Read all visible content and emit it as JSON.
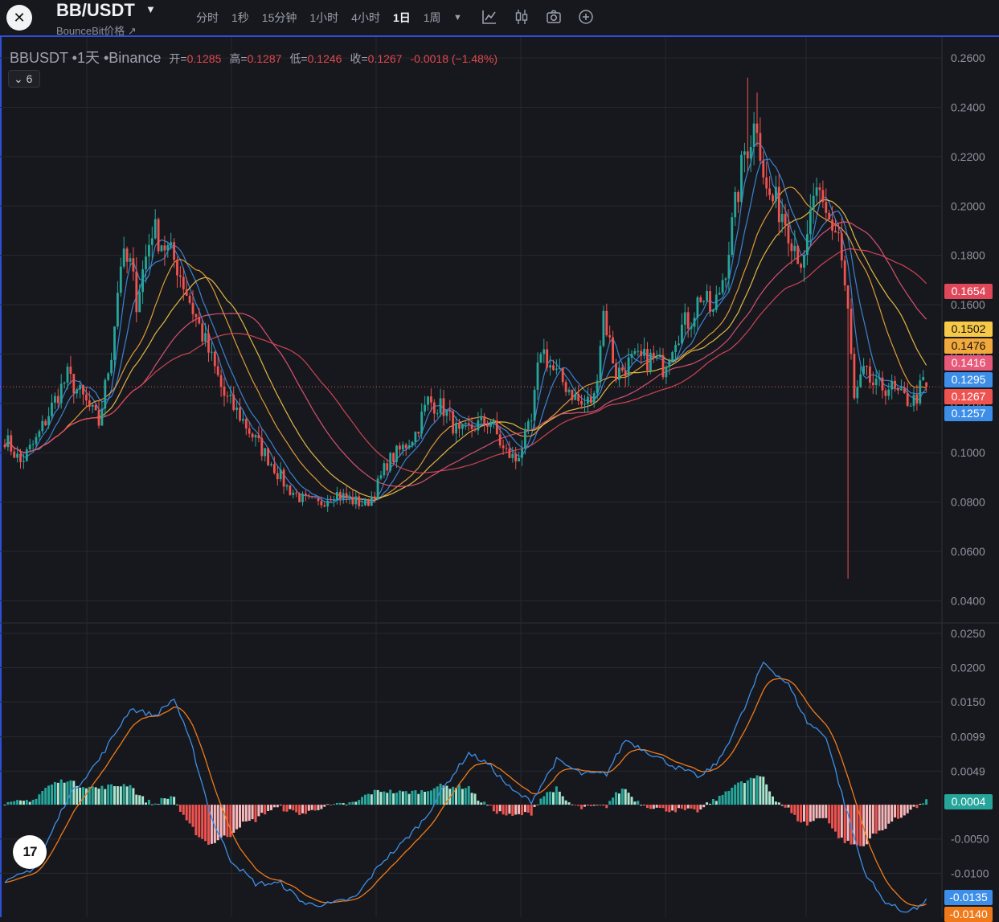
{
  "header": {
    "logo_glyph": "✕",
    "symbol": "BB/USDT",
    "subtitle": "BounceBit价格 ↗",
    "intervals": [
      {
        "label": "分时",
        "active": false
      },
      {
        "label": "1秒",
        "active": false
      },
      {
        "label": "15分钟",
        "active": false
      },
      {
        "label": "1小时",
        "active": false
      },
      {
        "label": "4小时",
        "active": false
      },
      {
        "label": "1日",
        "active": true
      },
      {
        "label": "1周",
        "active": false
      }
    ],
    "more_icon": "▼",
    "tools": [
      "line-chart-icon",
      "candle-icon",
      "camera-icon",
      "add-icon"
    ]
  },
  "legend": {
    "pair": "BBUSDT •1天 •Binance",
    "open_label": "开=",
    "open": "0.1285",
    "high_label": "高=",
    "high": "0.1287",
    "low_label": "低=",
    "low": "0.1246",
    "close_label": "收=",
    "close": "0.1267",
    "change": "-0.0018 (−1.48%)",
    "indicator_count": "⌄ 6"
  },
  "tv_logo": "17",
  "colors": {
    "up": "#26a69a",
    "down": "#ef5350",
    "up_light": "#a8e6cf",
    "down_light": "#f8b8bb",
    "ma1": "#3d8ee8",
    "ma2": "#f2a93b",
    "ma3": "#e8587a",
    "ma4": "#f7c948",
    "ma5": "#e0485a",
    "macd": "#3d8ee8",
    "signal": "#f07a1a",
    "grid": "#26282f"
  },
  "chart_data": {
    "type": "candlestick",
    "symbol": "BBUSDT",
    "timeframe": "1天",
    "exchange": "Binance",
    "price_axis": {
      "range": [
        0.031,
        0.2685
      ],
      "ticks": [
        "0.2600",
        "0.2400",
        "0.2200",
        "0.2000",
        "0.1800",
        "0.1600",
        "0.1400",
        "0.1200",
        "0.1000",
        "0.0800",
        "0.0600",
        "0.0400"
      ]
    },
    "ma_badges": [
      {
        "value": "0.1654",
        "color": "#e0485a"
      },
      {
        "value": "0.1502",
        "color": "#f7c948"
      },
      {
        "value": "0.1476",
        "color": "#f2a93b"
      },
      {
        "value": "0.1416",
        "color": "#e8587a"
      },
      {
        "value": "0.1295",
        "color": "#3d8ee8"
      },
      {
        "value": "0.1267",
        "color": "#ef5350"
      },
      {
        "value": "0.1257",
        "color": "#3d8ee8"
      }
    ],
    "current_price": 0.1267,
    "macd_axis": {
      "range": [
        -0.0164,
        0.0265
      ],
      "ticks": [
        "0.0250",
        "0.0200",
        "0.0150",
        "0.0099",
        "0.0049",
        "-0.0050",
        "-0.0100"
      ]
    },
    "macd_badges": [
      {
        "value": "0.0004",
        "color": "#26a69a"
      },
      {
        "value": "-0.0135",
        "color": "#3d8ee8"
      },
      {
        "value": "-0.0140",
        "color": "#f07a1a"
      }
    ],
    "close_waypoints": [
      [
        0,
        0.106
      ],
      [
        5,
        0.096
      ],
      [
        10,
        0.105
      ],
      [
        17,
        0.124
      ],
      [
        20,
        0.131
      ],
      [
        25,
        0.122
      ],
      [
        30,
        0.112
      ],
      [
        34,
        0.141
      ],
      [
        37,
        0.178
      ],
      [
        40,
        0.176
      ],
      [
        42,
        0.162
      ],
      [
        47,
        0.191
      ],
      [
        51,
        0.184
      ],
      [
        55,
        0.176
      ],
      [
        60,
        0.158
      ],
      [
        65,
        0.141
      ],
      [
        70,
        0.123
      ],
      [
        75,
        0.115
      ],
      [
        80,
        0.105
      ],
      [
        85,
        0.096
      ],
      [
        90,
        0.086
      ],
      [
        95,
        0.081
      ],
      [
        100,
        0.079
      ],
      [
        105,
        0.084
      ],
      [
        110,
        0.081
      ],
      [
        115,
        0.079
      ],
      [
        118,
        0.084
      ],
      [
        122,
        0.096
      ],
      [
        127,
        0.102
      ],
      [
        131,
        0.108
      ],
      [
        135,
        0.121
      ],
      [
        140,
        0.118
      ],
      [
        145,
        0.107
      ],
      [
        150,
        0.111
      ],
      [
        155,
        0.113
      ],
      [
        159,
        0.101
      ],
      [
        163,
        0.097
      ],
      [
        168,
        0.112
      ],
      [
        171,
        0.143
      ],
      [
        175,
        0.133
      ],
      [
        180,
        0.126
      ],
      [
        184,
        0.119
      ],
      [
        188,
        0.122
      ],
      [
        191,
        0.157
      ],
      [
        195,
        0.132
      ],
      [
        200,
        0.137
      ],
      [
        206,
        0.138
      ],
      [
        210,
        0.135
      ],
      [
        214,
        0.148
      ],
      [
        219,
        0.155
      ],
      [
        222,
        0.164
      ],
      [
        226,
        0.156
      ],
      [
        230,
        0.176
      ],
      [
        233,
        0.199
      ],
      [
        236,
        0.222
      ],
      [
        240,
        0.235
      ],
      [
        243,
        0.205
      ],
      [
        248,
        0.198
      ],
      [
        252,
        0.185
      ],
      [
        255,
        0.175
      ],
      [
        258,
        0.205
      ],
      [
        262,
        0.195
      ],
      [
        266,
        0.189
      ],
      [
        269,
        0.156
      ],
      [
        271,
        0.121
      ],
      [
        274,
        0.132
      ],
      [
        278,
        0.126
      ],
      [
        282,
        0.127
      ],
      [
        286,
        0.122
      ],
      [
        290,
        0.121
      ],
      [
        293,
        0.128
      ],
      [
        294,
        0.1267
      ]
    ],
    "macd_waypoints": [
      [
        0,
        -0.0115
      ],
      [
        10,
        -0.009
      ],
      [
        20,
        0.001
      ],
      [
        30,
        0.0065
      ],
      [
        40,
        0.014
      ],
      [
        48,
        0.013
      ],
      [
        54,
        0.0155
      ],
      [
        60,
        0.008
      ],
      [
        66,
        -0.002
      ],
      [
        72,
        -0.008
      ],
      [
        80,
        -0.0115
      ],
      [
        88,
        -0.0115
      ],
      [
        96,
        -0.0145
      ],
      [
        104,
        -0.0145
      ],
      [
        112,
        -0.0135
      ],
      [
        120,
        -0.0085
      ],
      [
        126,
        -0.006
      ],
      [
        134,
        -0.002
      ],
      [
        140,
        0.0025
      ],
      [
        148,
        0.0075
      ],
      [
        154,
        0.006
      ],
      [
        162,
        0.002
      ],
      [
        168,
        0.0005
      ],
      [
        176,
        0.0065
      ],
      [
        184,
        0.0045
      ],
      [
        192,
        0.0045
      ],
      [
        198,
        0.0095
      ],
      [
        206,
        0.0075
      ],
      [
        214,
        0.0055
      ],
      [
        222,
        0.004
      ],
      [
        228,
        0.0065
      ],
      [
        236,
        0.014
      ],
      [
        242,
        0.0208
      ],
      [
        250,
        0.0175
      ],
      [
        256,
        0.012
      ],
      [
        262,
        0.01
      ],
      [
        268,
        0
      ],
      [
        274,
        -0.0095
      ],
      [
        280,
        -0.0138
      ],
      [
        286,
        -0.0155
      ],
      [
        292,
        -0.015
      ],
      [
        294,
        -0.0135
      ]
    ]
  }
}
